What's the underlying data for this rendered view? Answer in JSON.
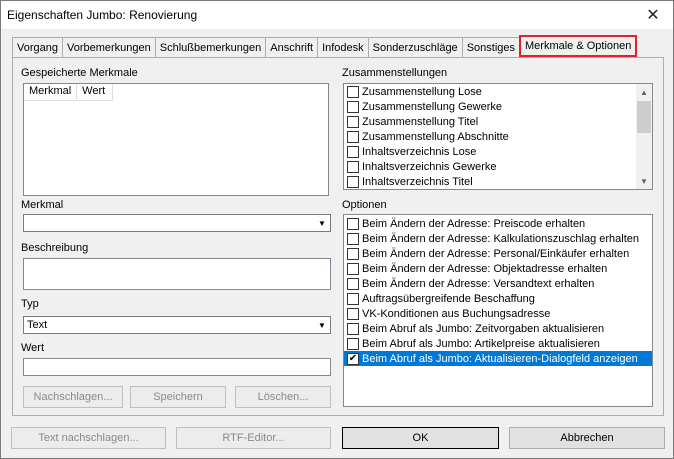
{
  "window": {
    "title": "Eigenschaften Jumbo: Renovierung",
    "close_glyph": "✕"
  },
  "tabs": [
    {
      "label": "Vorgang"
    },
    {
      "label": "Vorbemerkungen"
    },
    {
      "label": "Schlußbemerkungen"
    },
    {
      "label": "Anschrift"
    },
    {
      "label": "Infodesk"
    },
    {
      "label": "Sonderzuschläge"
    },
    {
      "label": "Sonstiges"
    },
    {
      "label": "Merkmale & Optionen",
      "active": true
    }
  ],
  "left": {
    "saved_label": "Gespeicherte Merkmale",
    "saved_columns": [
      "Merkmal",
      "Wert"
    ],
    "merkmal_label": "Merkmal",
    "merkmal_value": "",
    "beschreibung_label": "Beschreibung",
    "beschreibung_value": "",
    "typ_label": "Typ",
    "typ_value": "Text",
    "wert_label": "Wert",
    "wert_value": "",
    "btn_nachschlagen": "Nachschlagen...",
    "btn_speichern": "Speichern",
    "btn_loeschen": "Löschen..."
  },
  "right": {
    "zusammen_label": "Zusammenstellungen",
    "zusammen_items": [
      {
        "label": "Zusammenstellung Lose",
        "checked": false
      },
      {
        "label": "Zusammenstellung Gewerke",
        "checked": false
      },
      {
        "label": "Zusammenstellung Titel",
        "checked": false
      },
      {
        "label": "Zusammenstellung Abschnitte",
        "checked": false
      },
      {
        "label": "Inhaltsverzeichnis Lose",
        "checked": false
      },
      {
        "label": "Inhaltsverzeichnis Gewerke",
        "checked": false
      },
      {
        "label": "Inhaltsverzeichnis Titel",
        "checked": false
      }
    ],
    "optionen_label": "Optionen",
    "optionen_items": [
      {
        "label": "Beim Ändern der Adresse: Preiscode erhalten",
        "checked": false
      },
      {
        "label": "Beim Ändern der Adresse: Kalkulationszuschlag erhalten",
        "checked": false
      },
      {
        "label": "Beim Ändern der Adresse: Personal/Einkäufer erhalten",
        "checked": false
      },
      {
        "label": "Beim Ändern der Adresse: Objektadresse erhalten",
        "checked": false
      },
      {
        "label": "Beim Ändern der Adresse: Versandtext erhalten",
        "checked": false
      },
      {
        "label": "Auftragsübergreifende Beschaffung",
        "checked": false
      },
      {
        "label": "VK-Konditionen aus Buchungsadresse",
        "checked": false
      },
      {
        "label": "Beim Abruf als Jumbo: Zeitvorgaben aktualisieren",
        "checked": false
      },
      {
        "label": "Beim Abruf als Jumbo: Artikelpreise aktualisieren",
        "checked": false
      },
      {
        "label": "Beim Abruf als Jumbo: Aktualisieren-Dialogfeld anzeigen",
        "checked": true,
        "selected": true
      }
    ]
  },
  "footer": {
    "btn_textnachschlagen": "Text nachschlagen...",
    "btn_rtf": "RTF-Editor...",
    "btn_ok": "OK",
    "btn_abbrechen": "Abbrechen"
  },
  "colors": {
    "selection": "#0078d7",
    "active_tab_highlight": "#e5202e"
  }
}
